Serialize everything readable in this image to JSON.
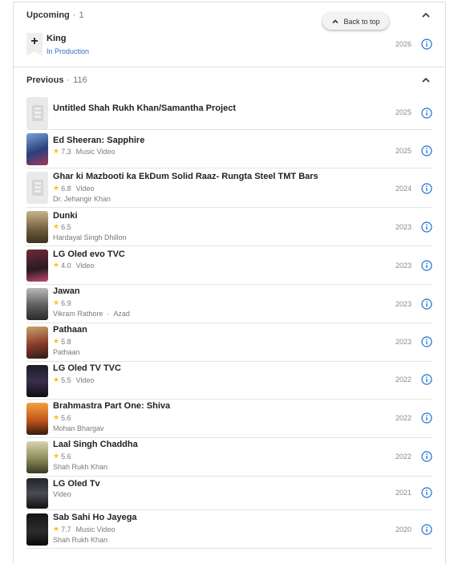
{
  "upcoming": {
    "title": "Upcoming",
    "sep": "·",
    "count": "1",
    "item": {
      "title": "King",
      "status": "In Production",
      "year": "2026"
    }
  },
  "back_to_top": "Back to top",
  "previous": {
    "title": "Previous",
    "sep": "·",
    "count": "116",
    "items": [
      {
        "title": "Untitled Shah Rukh Khan/Samantha Project",
        "year": "2025"
      },
      {
        "title": "Ed Sheeran: Sapphire",
        "rating": "7.3",
        "type": "Music Video",
        "year": "2025"
      },
      {
        "title": "Ghar ki Mazbooti ka EkDum Solid Raaz- Rungta Steel TMT Bars",
        "rating": "6.8",
        "type": "Video",
        "role": "Dr. Jehangir Khan",
        "year": "2024"
      },
      {
        "title": "Dunki",
        "rating": "6.5",
        "role": "Hardayal Singh Dhillon",
        "year": "2023"
      },
      {
        "title": "LG Oled evo TVC",
        "rating": "4.0",
        "type": "Video",
        "year": "2023"
      },
      {
        "title": "Jawan",
        "rating": "6.9",
        "role": "Vikram Rathore",
        "role2": "Azad",
        "year": "2023"
      },
      {
        "title": "Pathaan",
        "rating": "5.8",
        "role": "Pathaan",
        "year": "2023"
      },
      {
        "title": "LG Oled TV TVC",
        "rating": "5.5",
        "type": "Video",
        "year": "2022"
      },
      {
        "title": "Brahmastra Part One: Shiva",
        "rating": "5.6",
        "role": "Mohan Bhargav",
        "year": "2022"
      },
      {
        "title": "Laal Singh Chaddha",
        "rating": "5.6",
        "role": "Shah Rukh Khan",
        "year": "2022"
      },
      {
        "title": "LG Oled Tv",
        "role": "Video",
        "year": "2021"
      },
      {
        "title": "Sab Sahi Ho Jayega",
        "rating": "7.7",
        "type": "Music Video",
        "role": "Shah Rukh Khan",
        "year": "2020"
      }
    ]
  },
  "icons": {
    "star": "star-icon",
    "info": "info-circle-icon",
    "chevron": "chevron-up-icon",
    "add": "plus-icon"
  },
  "colors": {
    "accent": "#1a6fd0",
    "star": "#f5c518",
    "link": "#2f6fc8"
  }
}
